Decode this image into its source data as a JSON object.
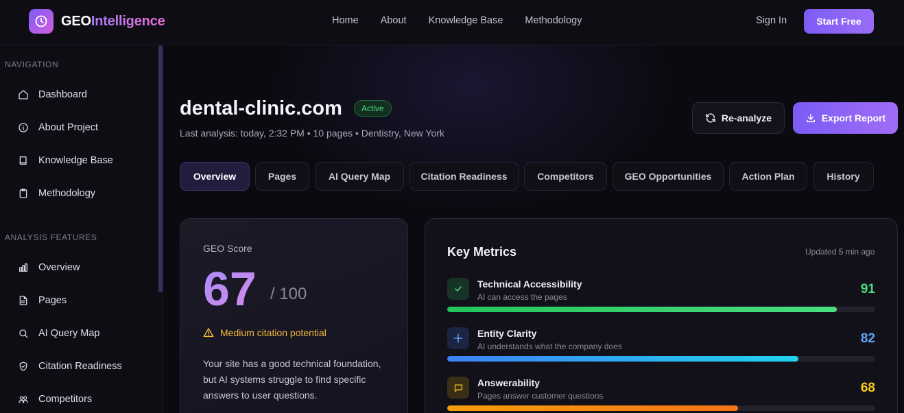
{
  "header": {
    "logo_part1": "GEO",
    "logo_part2": "Intelligence",
    "nav": [
      "Home",
      "About",
      "Knowledge Base",
      "Methodology"
    ],
    "sign_in": "Sign In",
    "start_free": "Start Free"
  },
  "sidebar": {
    "section_navigation": "NAVIGATION",
    "navigation_items": [
      {
        "label": "Dashboard",
        "icon": "home-icon"
      },
      {
        "label": "About Project",
        "icon": "info-icon"
      },
      {
        "label": "Knowledge Base",
        "icon": "book-icon"
      },
      {
        "label": "Methodology",
        "icon": "clipboard-icon"
      }
    ],
    "section_analysis": "ANALYSIS FEATURES",
    "analysis_items": [
      {
        "label": "Overview",
        "icon": "bar-chart-icon"
      },
      {
        "label": "Pages",
        "icon": "file-icon"
      },
      {
        "label": "AI Query Map",
        "icon": "search-icon"
      },
      {
        "label": "Citation Readiness",
        "icon": "shield-check-icon"
      },
      {
        "label": "Competitors",
        "icon": "users-icon"
      }
    ]
  },
  "project": {
    "domain": "dental-clinic.com",
    "status": "Active",
    "meta": "Last analysis: today, 2:32 PM • 10 pages • Dentistry, New York",
    "reanalyze_label": "Re-analyze",
    "export_label": "Export Report"
  },
  "tabs": [
    "Overview",
    "Pages",
    "AI Query Map",
    "Citation Readiness",
    "Competitors",
    "GEO Opportunities",
    "Action Plan",
    "History"
  ],
  "active_tab": "Overview",
  "score": {
    "label": "GEO Score",
    "value": "67",
    "max": "/ 100",
    "potential": "Medium citation potential",
    "description": "Your site has a good technical foundation, but AI systems struggle to find specific answers to user questions."
  },
  "metrics": {
    "title": "Key Metrics",
    "updated": "Updated 5 min ago",
    "items": [
      {
        "name": "Technical Accessibility",
        "sub": "AI can access the pages",
        "value": 91,
        "color": "#4ade80",
        "icon": "check-icon"
      },
      {
        "name": "Entity Clarity",
        "sub": "AI understands what the company does",
        "value": 82,
        "color": "#60a5fa",
        "icon": "sparkle-icon"
      },
      {
        "name": "Answerability",
        "sub": "Pages answer customer questions",
        "value": 68,
        "color": "#facc15",
        "icon": "message-icon"
      }
    ]
  },
  "colors": {
    "accent": "#7c5cf5",
    "success": "#4ade80",
    "warning": "#f5b93a",
    "info": "#60a5fa"
  }
}
